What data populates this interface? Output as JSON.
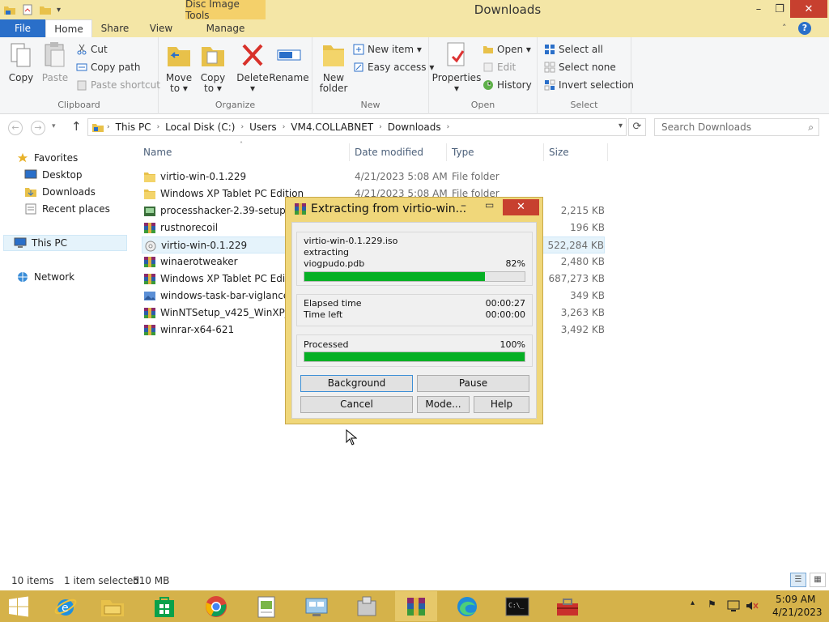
{
  "window": {
    "title": "Downloads",
    "context_tab": "Disc Image Tools",
    "controls": {
      "minimize": "–",
      "maximize": "❐",
      "close": "✕"
    }
  },
  "ribbon_tabs": {
    "file": "File",
    "home": "Home",
    "share": "Share",
    "view": "View",
    "manage": "Manage",
    "help": "?",
    "collapse": "˄"
  },
  "ribbon": {
    "clipboard": {
      "label": "Clipboard",
      "copy": "Copy",
      "paste": "Paste",
      "cut": "Cut",
      "copy_path": "Copy path",
      "paste_shortcut": "Paste shortcut"
    },
    "organize": {
      "label": "Organize",
      "move_to": "Move",
      "move_to2": "to ▾",
      "copy_to": "Copy",
      "copy_to2": "to ▾",
      "delete": "Delete",
      "delete2": "▾",
      "rename": "Rename"
    },
    "new": {
      "label": "New",
      "new_folder": "New",
      "new_folder2": "folder",
      "new_item": "New item ▾",
      "easy_access": "Easy access ▾"
    },
    "open": {
      "label": "Open",
      "properties": "Properties",
      "properties2": "▾",
      "open": "Open ▾",
      "edit": "Edit",
      "history": "History"
    },
    "select": {
      "label": "Select",
      "select_all": "Select all",
      "select_none": "Select none",
      "invert": "Invert selection"
    }
  },
  "address": {
    "back": "←",
    "forward": "→",
    "up": "↑",
    "crumbs": [
      "This PC",
      "Local Disk (C:)",
      "Users",
      "VM4.COLLABNET",
      "Downloads"
    ],
    "separator": "›",
    "dropdown": "▾",
    "refresh": "⟳",
    "search_placeholder": "Search Downloads",
    "search_icon": "⌕"
  },
  "nav": {
    "favorites": "Favorites",
    "desktop": "Desktop",
    "downloads": "Downloads",
    "recent": "Recent places",
    "this_pc": "This PC",
    "network": "Network"
  },
  "columns": {
    "name": "Name",
    "date": "Date modified",
    "type": "Type",
    "size": "Size",
    "sort_arrow": "˄"
  },
  "files": [
    {
      "name": "virtio-win-0.1.229",
      "date": "4/21/2023 5:08 AM",
      "type": "File folder",
      "size": "",
      "icon": "folder-icon"
    },
    {
      "name": "Windows XP Tablet PC Edition",
      "date": "4/21/2023 5:08 AM",
      "type": "File folder",
      "size": "",
      "icon": "folder-icon"
    },
    {
      "name": "processhacker-2.39-setup",
      "date": "",
      "type": "",
      "size": "2,215 KB",
      "icon": "setup-icon"
    },
    {
      "name": "rustnorecoil",
      "date": "",
      "type": "",
      "size": "196 KB",
      "icon": "winrar-icon"
    },
    {
      "name": "virtio-win-0.1.229",
      "date": "",
      "type": "",
      "size": "522,284 KB",
      "icon": "iso-icon"
    },
    {
      "name": "winaerotweaker",
      "date": "",
      "type": "",
      "size": "2,480 KB",
      "icon": "winrar-icon"
    },
    {
      "name": "Windows XP Tablet PC Edition",
      "date": "",
      "type": "",
      "size": "687,273 KB",
      "icon": "winrar-icon"
    },
    {
      "name": "windows-task-bar-viglance",
      "date": "",
      "type": "",
      "size": "349 KB",
      "icon": "image-icon"
    },
    {
      "name": "WinNTSetup_v425_WinXP_Su",
      "date": "",
      "type": "",
      "size": "3,263 KB",
      "icon": "winrar-icon"
    },
    {
      "name": "winrar-x64-621",
      "date": "",
      "type": "",
      "size": "3,492 KB",
      "icon": "winrar-icon"
    }
  ],
  "selected_index": 4,
  "status": {
    "items": "10 items",
    "selected": "1 item selected",
    "size": "510 MB"
  },
  "dialog": {
    "title": "Extracting from virtio-win...",
    "min": "–",
    "max": "▭",
    "close": "✕",
    "archive": "virtio-win-0.1.229.iso",
    "action": "extracting",
    "file": "viogpudo.pdb",
    "file_percent_text": "82%",
    "file_progress": 0.82,
    "elapsed_label": "Elapsed time",
    "elapsed_value": "00:00:27",
    "left_label": "Time left",
    "left_value": "00:00:00",
    "processed_label": "Processed",
    "processed_percent_text": "100%",
    "processed_progress": 1.0,
    "buttons": {
      "background": "Background",
      "pause": "Pause",
      "cancel": "Cancel",
      "mode": "Mode...",
      "help": "Help"
    }
  },
  "taskbar": {
    "items": [
      "start-icon",
      "ie-icon",
      "file-explorer-icon",
      "store-icon",
      "chrome-icon",
      "notepad-icon",
      "control-panel-icon",
      "tools-icon",
      "winrar-icon",
      "edge-icon",
      "cmd-icon",
      "toolbox-icon"
    ],
    "tray_chevron": "▴",
    "time": "5:09 AM",
    "date": "4/21/2023"
  },
  "colors": {
    "accent": "#2a6fc9",
    "titlebar": "#f4e6a6",
    "taskbar": "#d5b24a",
    "progress": "#06b025",
    "close": "#c7402f"
  }
}
